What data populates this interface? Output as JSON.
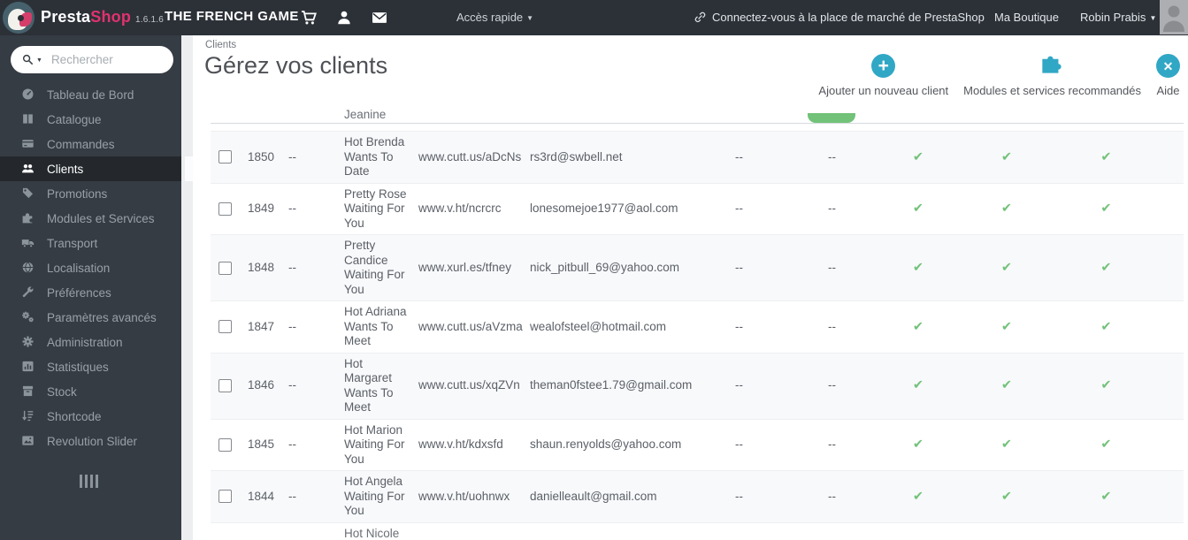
{
  "topbar": {
    "brand": {
      "name_left": "Presta",
      "name_right": "Shop",
      "version": "1.6.1.6"
    },
    "shop_name": "THE FRENCH GAME",
    "quick_access_label": "Accès rapide",
    "marketplace_link": "Connectez-vous à la place de marché de PrestaShop",
    "my_shop_label": "Ma Boutique",
    "user_name": "Robin Prabis"
  },
  "sidebar": {
    "search_placeholder": "Rechercher",
    "items": [
      {
        "label": "Tableau de Bord",
        "icon": "dashboard-icon",
        "active": false
      },
      {
        "label": "Catalogue",
        "icon": "catalog-icon",
        "active": false
      },
      {
        "label": "Commandes",
        "icon": "orders-icon",
        "active": false
      },
      {
        "label": "Clients",
        "icon": "customers-icon",
        "active": true
      },
      {
        "label": "Promotions",
        "icon": "promotions-icon",
        "active": false
      },
      {
        "label": "Modules et Services",
        "icon": "modules-icon",
        "active": false
      },
      {
        "label": "Transport",
        "icon": "shipping-icon",
        "active": false
      },
      {
        "label": "Localisation",
        "icon": "localization-icon",
        "active": false
      },
      {
        "label": "Préférences",
        "icon": "preferences-icon",
        "active": false
      },
      {
        "label": "Paramètres avancés",
        "icon": "advanced-settings-icon",
        "active": false
      },
      {
        "label": "Administration",
        "icon": "administration-icon",
        "active": false
      },
      {
        "label": "Statistiques",
        "icon": "stats-icon",
        "active": false
      },
      {
        "label": "Stock",
        "icon": "stock-icon",
        "active": false
      },
      {
        "label": "Shortcode",
        "icon": "shortcode-icon",
        "active": false
      },
      {
        "label": "Revolution Slider",
        "icon": "slider-icon",
        "active": false
      }
    ]
  },
  "page": {
    "breadcrumb": "Clients",
    "title": "Gérez vos clients",
    "actions": [
      {
        "name": "add-customer-button",
        "label": "Ajouter un nouveau client",
        "icon": "add-circle-icon"
      },
      {
        "name": "recommended-modules-button",
        "label": "Modules et services recommandés",
        "icon": "puzzle-icon"
      },
      {
        "name": "help-button",
        "label": "Aide",
        "icon": "help-icon"
      }
    ]
  },
  "table": {
    "top_partial_name": "Jeanine",
    "bottom_partial_name": "Hot Nicole",
    "rows": [
      {
        "id": "1850",
        "social_title": "--",
        "name": "Hot Brenda Wants To Date",
        "url": "www.cutt.us/aDcNs",
        "email": "rs3rd@swbell.net",
        "sales": "--",
        "registration": "--",
        "enabled": true,
        "newsletter": true,
        "optin": true
      },
      {
        "id": "1849",
        "social_title": "--",
        "name": "Pretty Rose Waiting For You",
        "url": "www.v.ht/ncrcrc",
        "email": "lonesomejoe1977@aol.com",
        "sales": "--",
        "registration": "--",
        "enabled": true,
        "newsletter": true,
        "optin": true
      },
      {
        "id": "1848",
        "social_title": "--",
        "name": "Pretty Candice Waiting For You",
        "url": "www.xurl.es/tfney",
        "email": "nick_pitbull_69@yahoo.com",
        "sales": "--",
        "registration": "--",
        "enabled": true,
        "newsletter": true,
        "optin": true
      },
      {
        "id": "1847",
        "social_title": "--",
        "name": "Hot Adriana Wants To Meet",
        "url": "www.cutt.us/aVzma",
        "email": "wealofsteel@hotmail.com",
        "sales": "--",
        "registration": "--",
        "enabled": true,
        "newsletter": true,
        "optin": true
      },
      {
        "id": "1846",
        "social_title": "--",
        "name": "Hot Margaret Wants To Meet",
        "url": "www.cutt.us/xqZVn",
        "email": "theman0fstee1.79@gmail.com",
        "sales": "--",
        "registration": "--",
        "enabled": true,
        "newsletter": true,
        "optin": true
      },
      {
        "id": "1845",
        "social_title": "--",
        "name": "Hot Marion Waiting For You",
        "url": "www.v.ht/kdxsfd",
        "email": "shaun.renyolds@yahoo.com",
        "sales": "--",
        "registration": "--",
        "enabled": true,
        "newsletter": true,
        "optin": true
      },
      {
        "id": "1844",
        "social_title": "--",
        "name": "Hot Angela Waiting For You",
        "url": "www.v.ht/uohnwx",
        "email": "danielleault@gmail.com",
        "sales": "--",
        "registration": "--",
        "enabled": true,
        "newsletter": true,
        "optin": true
      }
    ]
  },
  "colors": {
    "accent_blue": "#31A7C6",
    "success_green": "#72C279",
    "brand_pink": "#E0326E"
  }
}
